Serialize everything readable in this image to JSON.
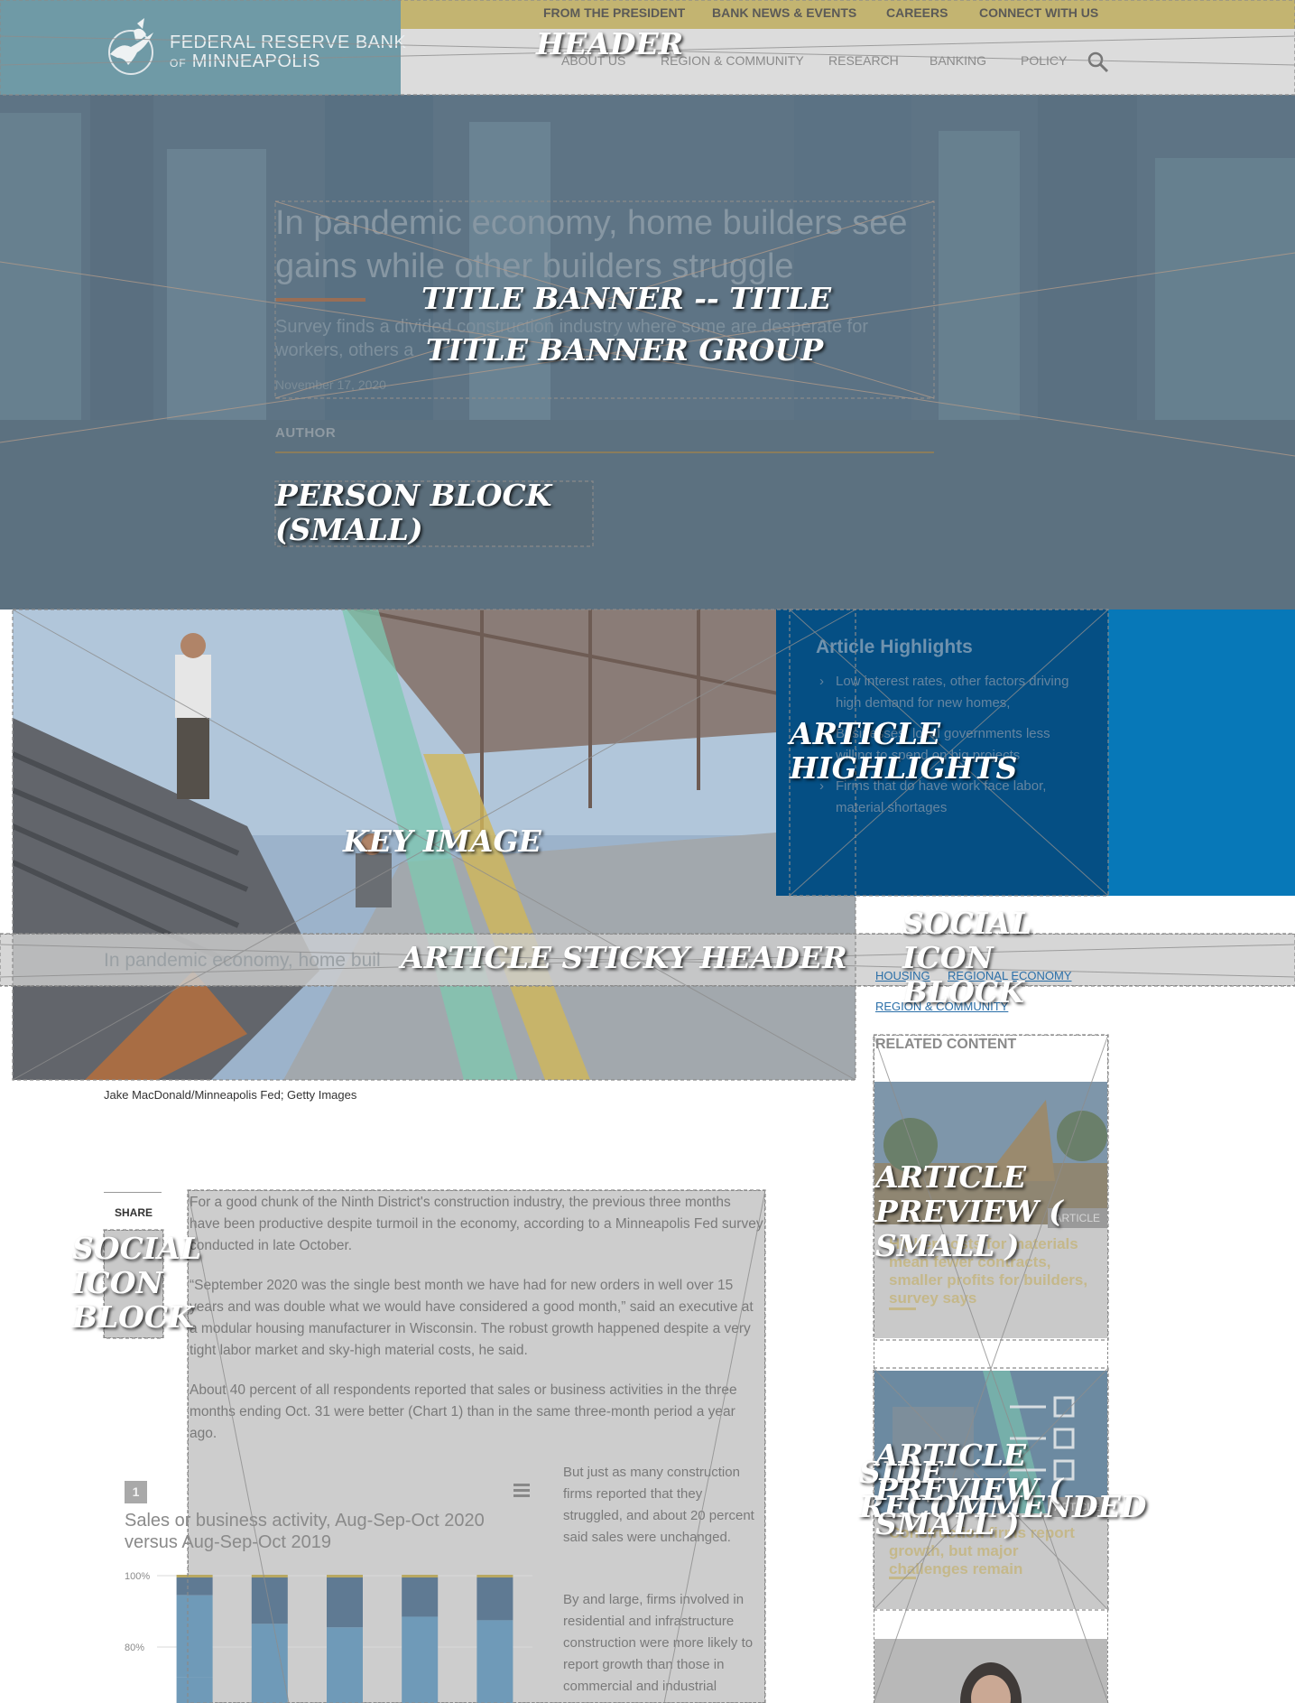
{
  "header": {
    "top_nav": [
      "FROM THE PRESIDENT",
      "BANK NEWS & EVENTS",
      "CAREERS",
      "CONNECT WITH US"
    ],
    "logo_line1": "FEDERAL RESERVE BANK",
    "logo_line2_prefix": "OF",
    "logo_line2": "MINNEAPOLIS",
    "main_nav": [
      "ABOUT US",
      "REGION & COMMUNITY",
      "RESEARCH",
      "BANKING",
      "POLICY"
    ],
    "search_icon": "search-icon"
  },
  "hero": {
    "title": "In pandemic economy, home builders see gains while other builders struggle",
    "subtitle": "Survey finds a divided construction industry where some are desperate for workers, others a",
    "date": "November 17, 2020",
    "author_label": "AUTHOR"
  },
  "highlights": {
    "title": "Article Highlights",
    "items": [
      "Low interest rates, other factors driving high demand for new homes,",
      "Businesses, local governments less willing to spend on big projects",
      "Firms that do have work face labor, material shortages"
    ]
  },
  "sticky_header": {
    "title": "In pandemic economy, home buil"
  },
  "tags": [
    "HOUSING",
    "REGIONAL ECONOMY",
    "REGION & COMMUNITY"
  ],
  "caption": "Jake MacDonald/Minneapolis Fed; Getty Images",
  "share": {
    "label": "SHARE"
  },
  "body": {
    "paragraphs": [
      "For a good chunk of the Ninth District's construction industry, the previous three months have been productive despite turmoil in the economy, according to a Minneapolis Fed survey conducted in late October.",
      "“September 2020 was the single best month we have had for new orders in well over 15 years and was double what we would have considered a good month,” said an executive at a modular housing manufacturer in Wisconsin. The robust growth happened despite a very tight labor market and sky-high material costs, he said.",
      "About 40 percent of all respondents reported that sales or business activities in the three months ending Oct. 31 were better (Chart 1) than in the same three-month period a year ago."
    ],
    "column_paragraphs": [
      "But just as many construction firms reported that they struggled, and about 20 percent said sales were unchanged.",
      "By and large, firms involved in residential and infrastructure construction were more likely to report growth than those in commercial and industrial"
    ]
  },
  "chart_data": {
    "type": "bar",
    "badge": "1",
    "title": "Sales or business activity, Aug-Sep-Oct 2020 versus Aug-Sep-Oct 2019",
    "ytick_labels": [
      "100%",
      "80%"
    ],
    "ylim": [
      75,
      100
    ],
    "series": [
      {
        "color": "#5f7a93",
        "values": [
          5,
          13,
          14,
          11,
          12
        ]
      },
      {
        "color": "#6f9ab8",
        "values": [
          23,
          0,
          0,
          0,
          0
        ]
      }
    ],
    "categories_count": 5
  },
  "sidebar": {
    "related_label": "RELATED CONTENT",
    "cards": [
      {
        "tag": "ARTICLE",
        "title": "Higher costs for materials mean fewer contracts, smaller profits for builders, survey says"
      },
      {
        "tag": "ARTICLE",
        "title": "Construction firms report growth, but major challenges remain"
      }
    ]
  },
  "annotations": [
    "HEADER",
    "TITLE BANNER -- TITLE",
    "TITLE BANNER GROUP",
    "PERSON BLOCK",
    "(SMALL)",
    "ARTICLE",
    "HIGHLIGHTS",
    "KEY IMAGE",
    "SOCIAL",
    "ICON",
    "BLOCK",
    "ARTICLE STICKY HEADER",
    "ARTICLE",
    "PREVIEW (",
    "SMALL )",
    "SIDE",
    "RECOMMENDED",
    "SOCIAL",
    "ICON",
    "BLOCK",
    "ARTICLE",
    "PREVIEW (",
    "SMALL )"
  ]
}
